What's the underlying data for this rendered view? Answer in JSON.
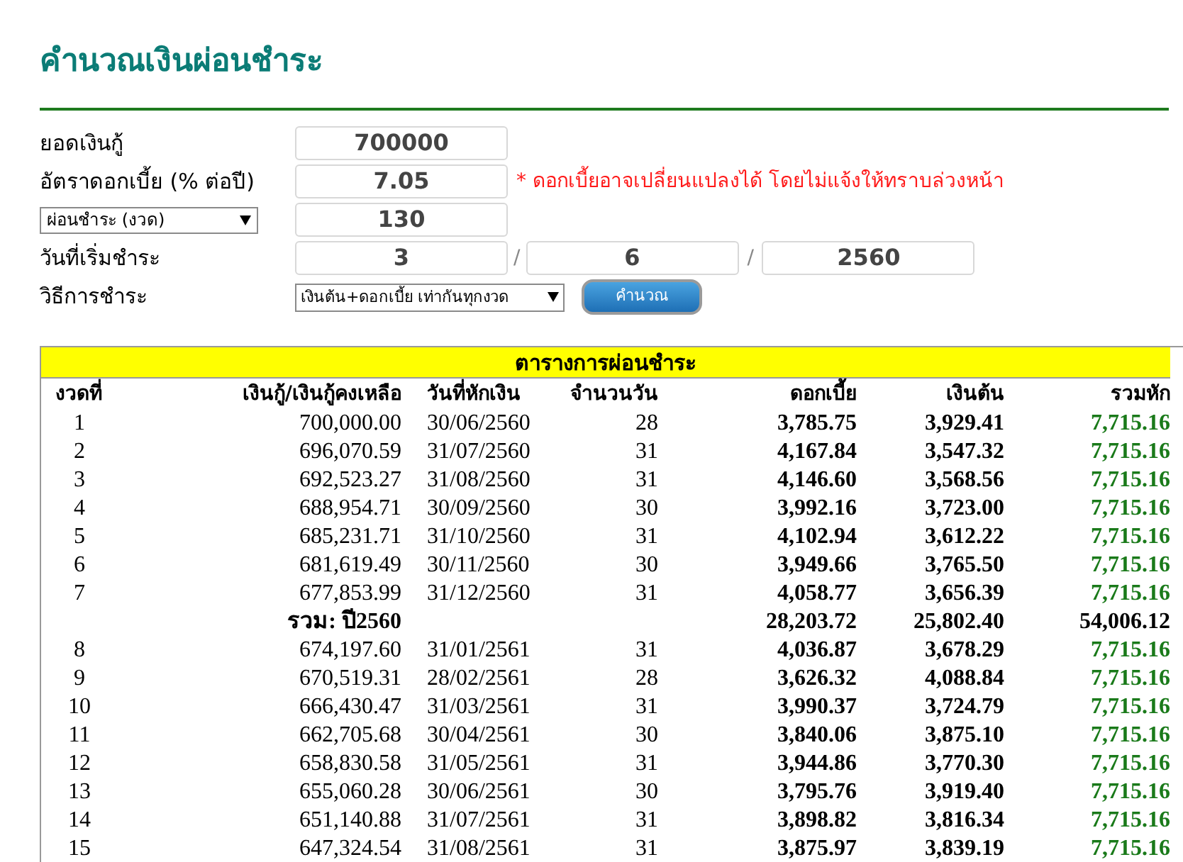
{
  "title": "คำนวณเงินผ่อนชำระ",
  "form": {
    "loan_label": "ยอดเงินกู้",
    "loan_value": "700000",
    "rate_label": "อัตราดอกเบี้ย (% ต่อปี)",
    "rate_value": "7.05",
    "rate_note": "* ดอกเบี้ยอาจเปลี่ยนแปลงได้ โดยไม่แจ้งให้ทราบล่วงหน้า",
    "term_select": "ผ่อนชำระ (งวด)",
    "term_value": "130",
    "start_label": "วันที่เริ่มชำระ",
    "start_day": "3",
    "separator_1": "/",
    "start_month": "6",
    "separator_2": "/",
    "start_year": "2560",
    "method_label": "วิธีการชำระ",
    "method_select": "เงินต้น+ดอกเบี้ย เท่ากันทุกงวด",
    "calculate_button": "คำนวณ"
  },
  "table": {
    "title": "ตารางการผ่อนชำระ",
    "columns": [
      "งวดที่",
      "เงินกู้/เงินกู้คงเหลือ",
      "วันที่หักเงิน",
      "จำนวนวัน",
      "ดอกเบี้ย",
      "เงินต้น",
      "รวมหัก"
    ],
    "rows": [
      {
        "kind": "installment",
        "cells": [
          "1",
          "700,000.00",
          "30/06/2560",
          "28",
          "3,785.75",
          "3,929.41",
          "7,715.16"
        ]
      },
      {
        "kind": "installment",
        "cells": [
          "2",
          "696,070.59",
          "31/07/2560",
          "31",
          "4,167.84",
          "3,547.32",
          "7,715.16"
        ]
      },
      {
        "kind": "installment",
        "cells": [
          "3",
          "692,523.27",
          "31/08/2560",
          "31",
          "4,146.60",
          "3,568.56",
          "7,715.16"
        ]
      },
      {
        "kind": "installment",
        "cells": [
          "4",
          "688,954.71",
          "30/09/2560",
          "30",
          "3,992.16",
          "3,723.00",
          "7,715.16"
        ]
      },
      {
        "kind": "installment",
        "cells": [
          "5",
          "685,231.71",
          "31/10/2560",
          "31",
          "4,102.94",
          "3,612.22",
          "7,715.16"
        ]
      },
      {
        "kind": "installment",
        "cells": [
          "6",
          "681,619.49",
          "30/11/2560",
          "30",
          "3,949.66",
          "3,765.50",
          "7,715.16"
        ]
      },
      {
        "kind": "installment",
        "cells": [
          "7",
          "677,853.99",
          "31/12/2560",
          "31",
          "4,058.77",
          "3,656.39",
          "7,715.16"
        ]
      },
      {
        "kind": "subtotal",
        "cells": [
          "",
          "รวม: ปี2560",
          "",
          "",
          "28,203.72",
          "25,802.40",
          "54,006.12"
        ]
      },
      {
        "kind": "installment",
        "cells": [
          "8",
          "674,197.60",
          "31/01/2561",
          "31",
          "4,036.87",
          "3,678.29",
          "7,715.16"
        ]
      },
      {
        "kind": "installment",
        "cells": [
          "9",
          "670,519.31",
          "28/02/2561",
          "28",
          "3,626.32",
          "4,088.84",
          "7,715.16"
        ]
      },
      {
        "kind": "installment",
        "cells": [
          "10",
          "666,430.47",
          "31/03/2561",
          "31",
          "3,990.37",
          "3,724.79",
          "7,715.16"
        ]
      },
      {
        "kind": "installment",
        "cells": [
          "11",
          "662,705.68",
          "30/04/2561",
          "30",
          "3,840.06",
          "3,875.10",
          "7,715.16"
        ]
      },
      {
        "kind": "installment",
        "cells": [
          "12",
          "658,830.58",
          "31/05/2561",
          "31",
          "3,944.86",
          "3,770.30",
          "7,715.16"
        ]
      },
      {
        "kind": "installment",
        "cells": [
          "13",
          "655,060.28",
          "30/06/2561",
          "30",
          "3,795.76",
          "3,919.40",
          "7,715.16"
        ]
      },
      {
        "kind": "installment",
        "cells": [
          "14",
          "651,140.88",
          "31/07/2561",
          "31",
          "3,898.82",
          "3,816.34",
          "7,715.16"
        ]
      },
      {
        "kind": "installment",
        "cells": [
          "15",
          "647,324.54",
          "31/08/2561",
          "31",
          "3,875.97",
          "3,839.19",
          "7,715.16"
        ]
      }
    ]
  }
}
